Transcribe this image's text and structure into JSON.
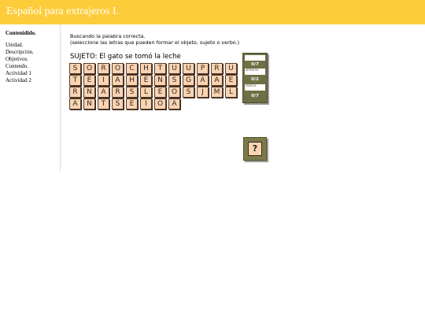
{
  "header": {
    "title": "Español para extrajeros I."
  },
  "sidebar": {
    "heading": "Contenidido.",
    "items": [
      "Unidad.",
      "Descripción.",
      "Objetivos.",
      "Contendo.",
      "Actividad 1",
      "Actividad 2"
    ]
  },
  "instructions": {
    "line1": "Buscando la palabra correcta.",
    "line2": "(seleccione las letras que pueden formar el objeto, sujeto o verbo.)"
  },
  "puzzle": {
    "sentence": "SUJETO: El gato se tomó la leche",
    "rows": [
      [
        "S",
        "O",
        "R",
        "O",
        "C",
        "H",
        "T",
        "U",
        "U",
        "P",
        "R",
        "U"
      ],
      [
        "T",
        "E",
        "I",
        "A",
        "H",
        "E",
        "N",
        "S",
        "G",
        "A",
        "A",
        "E"
      ],
      [
        "R",
        "N",
        "A",
        "R",
        "S",
        "L",
        "E",
        "O",
        "S",
        "J",
        "M",
        "L"
      ],
      [
        "A",
        "N",
        "T",
        "S",
        "E",
        "I",
        "O",
        "A"
      ]
    ]
  },
  "score": {
    "total": "0/7",
    "attempts_label": "INTENTOS:",
    "attempts": "0/2",
    "points_label": "PUNTOS:",
    "points": "0/7"
  },
  "help": {
    "label": "?"
  }
}
